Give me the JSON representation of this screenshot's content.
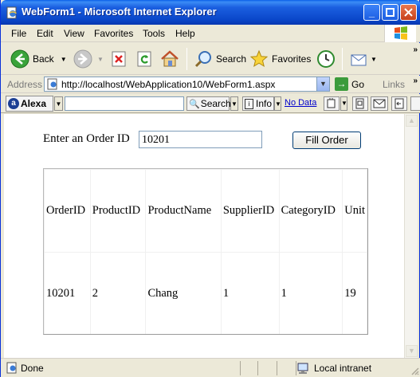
{
  "window": {
    "title": "WebForm1 - Microsoft Internet Explorer"
  },
  "menu": [
    "File",
    "Edit",
    "View",
    "Favorites",
    "Tools",
    "Help"
  ],
  "toolbar": {
    "back": "Back",
    "search": "Search",
    "favorites": "Favorites"
  },
  "address": {
    "label": "Address",
    "url": "http://localhost/WebApplication10/WebForm1.aspx",
    "go": "Go",
    "links": "Links"
  },
  "alexa": {
    "brand": "Alexa",
    "search": "Search",
    "info": "Info",
    "no_data": "No Data"
  },
  "form": {
    "label": "Enter an Order ID",
    "order_id_value": "10201",
    "button": "Fill Order"
  },
  "grid": {
    "headers": [
      "OrderID",
      "ProductID",
      "ProductName",
      "SupplierID",
      "CategoryID",
      "Unit"
    ],
    "rows": [
      [
        "10201",
        "2",
        "Chang",
        "1",
        "1",
        "19"
      ]
    ]
  },
  "status": {
    "text": "Done",
    "zone": "Local intranet"
  }
}
